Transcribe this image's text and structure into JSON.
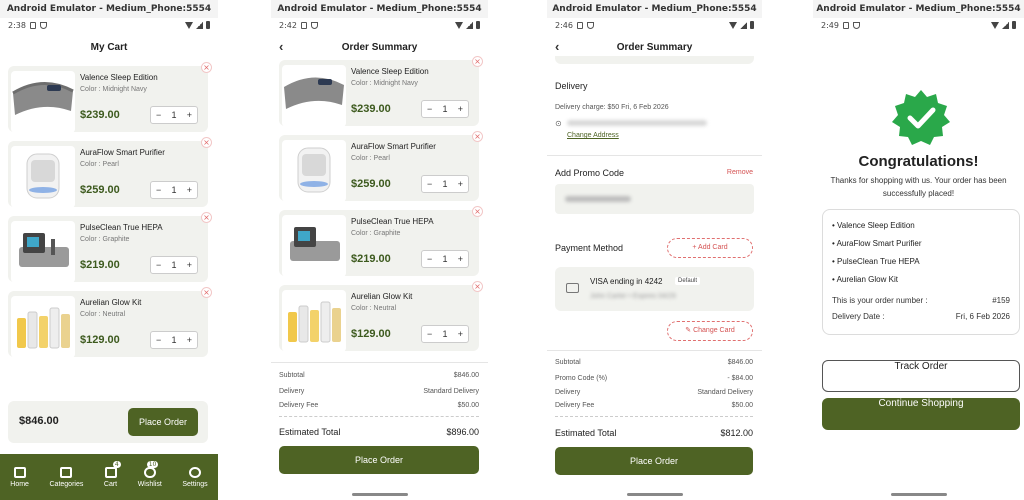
{
  "emulator_title": "Android Emulator - Medium_Phone:5554",
  "colors": {
    "accent": "#4e6324",
    "price": "#3d5a1e",
    "remove": "#d45252"
  },
  "cart": {
    "time": "2:38",
    "title": "My Cart",
    "items": [
      {
        "name": "Valence Sleep Edition",
        "color": "Color : Midnight Navy",
        "price": "$239.00",
        "qty": "1"
      },
      {
        "name": "AuraFlow Smart Purifier",
        "color": "Color : Pearl",
        "price": "$259.00",
        "qty": "1"
      },
      {
        "name": "PulseClean True HEPA",
        "color": "Color : Graphite",
        "price": "$219.00",
        "qty": "1"
      },
      {
        "name": "Aurelian Glow Kit",
        "color": "Color : Neutral",
        "price": "$129.00",
        "qty": "1"
      }
    ],
    "total": "$846.00",
    "place_order": "Place Order",
    "nav": [
      {
        "label": "Home",
        "icon": "home-icon"
      },
      {
        "label": "Categories",
        "icon": "grid-icon"
      },
      {
        "label": "Cart",
        "icon": "cart-icon",
        "badge": "4"
      },
      {
        "label": "Wishlist",
        "icon": "heart-icon",
        "badge": "10"
      },
      {
        "label": "Settings",
        "icon": "gear-icon"
      }
    ]
  },
  "summary": {
    "time": "2:42",
    "title": "Order Summary",
    "subtotal_label": "Subtotal",
    "subtotal": "$846.00",
    "delivery_label": "Delivery",
    "delivery": "Standard Delivery",
    "fee_label": "Delivery Fee",
    "fee": "$50.00",
    "est_label": "Estimated Total",
    "est": "$896.00",
    "place_order": "Place Order"
  },
  "summary2": {
    "time": "2:46",
    "title": "Order Summary",
    "delivery_heading": "Delivery",
    "delivery_charge": "Delivery charge: $50  Fri, 6 Feb 2026",
    "change_address": "Change Address",
    "promo_heading": "Add Promo Code",
    "remove": "Remove",
    "payment_heading": "Payment Method",
    "add_card": "+ Add Card",
    "card_name": "VISA ending in 4242",
    "card_default": "Default",
    "card_holder": "John Carter • Expires 04/29",
    "change_card": "Change Card",
    "subtotal_label": "Subtotal",
    "subtotal": "$846.00",
    "promo_label": "Promo Code (%)",
    "promo": "- $84.00",
    "delivery_label": "Delivery",
    "delivery": "Standard Delivery",
    "fee_label": "Delivery Fee",
    "fee": "$50.00",
    "est_label": "Estimated Total",
    "est": "$812.00",
    "place_order": "Place Order"
  },
  "success": {
    "time": "2:49",
    "heading": "Congratulations!",
    "message": "Thanks for shopping with us. Your order has been successfully placed!",
    "items": [
      "Valence Sleep Edition",
      "AuraFlow Smart Purifier",
      "PulseClean True HEPA",
      "Aurelian Glow Kit"
    ],
    "order_label": "This is your order number :",
    "order_number": "#159",
    "date_label": "Delivery Date :",
    "date": "Fri, 6 Feb 2026",
    "track": "Track Order",
    "continue": "Continue Shopping"
  }
}
